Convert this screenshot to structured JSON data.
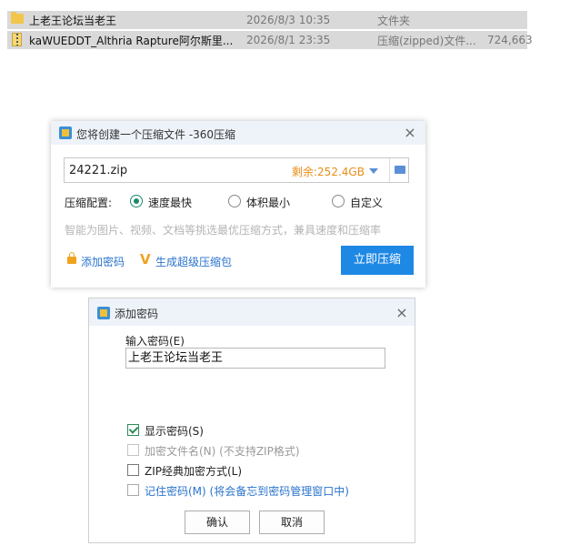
{
  "files": [
    {
      "name": "上老王论坛当老王",
      "date": "2026/8/3 10:35",
      "type": "文件夹",
      "size": "",
      "icon": "folder-icon"
    },
    {
      "name": "kaWUEDDT_Althria Rapture阿尔斯里...",
      "date": "2026/8/1 23:35",
      "type": "压缩(zipped)文件...",
      "size": "724,663",
      "icon": "zip-icon"
    }
  ],
  "compress_dialog": {
    "title": "您将创建一个压缩文件 -360压缩",
    "filename": "24221.zip",
    "free_space": "剩余:252.4GB",
    "config_label": "压缩配置:",
    "options": [
      "速度最快",
      "体积最小",
      "自定义"
    ],
    "selected_option": "速度最快",
    "hint": "智能为图片、视频、文档等挑选最优压缩方式，兼具速度和压缩率",
    "add_password": "添加密码",
    "super_pack": "生成超级压缩包",
    "compress_now": "立即压缩",
    "accent": "#1e88e5"
  },
  "password_dialog": {
    "title": "添加密码",
    "input_label": "输入密码(E)",
    "password_value": "上老王论坛当老王",
    "show_password": "显示密码(S)",
    "encrypt_names": "加密文件名(N) (不支持ZIP格式)",
    "zip_classic": "ZIP经典加密方式(L)",
    "remember": "记住密码(M) (将会备忘到密码管理窗口中)",
    "ok": "确认",
    "cancel": "取消"
  }
}
